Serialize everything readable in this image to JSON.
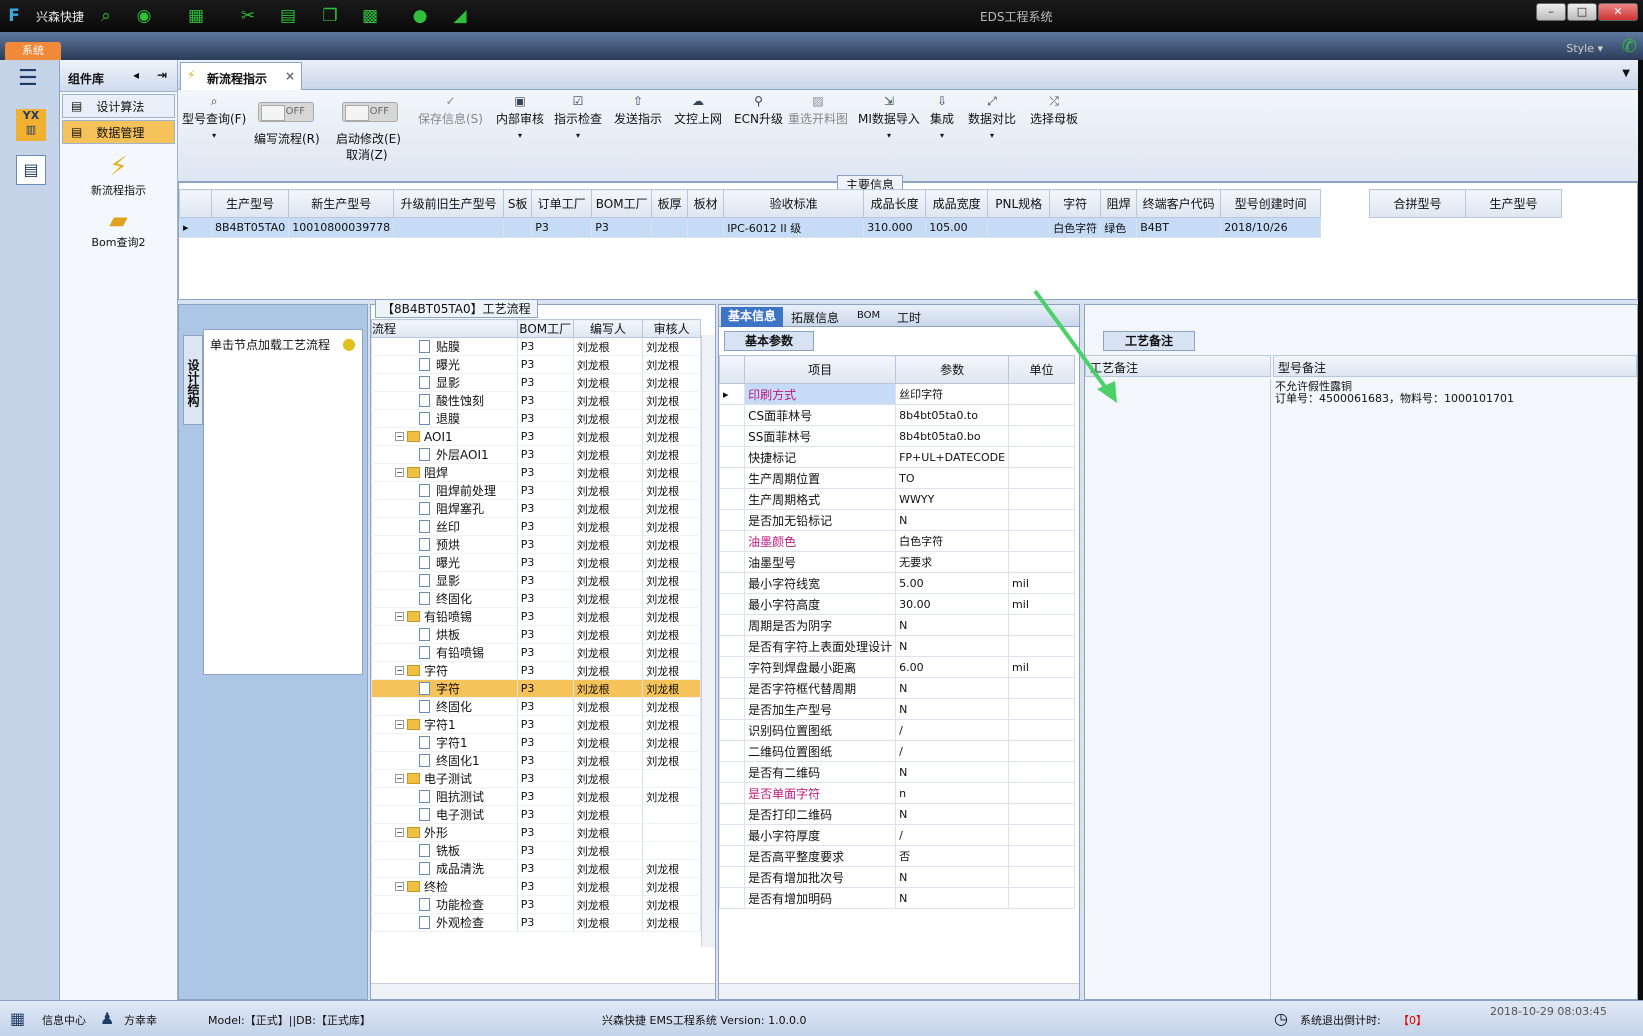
{
  "app": {
    "short_title": "兴森快捷",
    "window_title": "EDS工程系统",
    "system_tab": "系统",
    "style_label": "Style ▾"
  },
  "sidebar": {
    "header": "组件库",
    "items": [
      {
        "label": "设计算法"
      },
      {
        "label": "数据管理"
      }
    ],
    "big_items": [
      {
        "label": "新流程指示"
      },
      {
        "label": "Bom查询2"
      }
    ]
  },
  "tab": {
    "label": "新流程指示",
    "close": "×"
  },
  "toolbar": {
    "model_query": "型号查询(F)",
    "write_flow": "编写流程(R)",
    "start_modify": "启动修改(E)",
    "cancel": "取消(Z)",
    "toggle_off": "OFF",
    "buttons": [
      "保存信息(S)",
      "内部审核",
      "指示检查",
      "发送指示",
      "文控上网",
      "ECN升级",
      "重选开料图",
      "MI数据导入",
      "集成",
      "数据对比",
      "选择母板"
    ]
  },
  "main_info": {
    "title": "主要信息",
    "columns": [
      "生产型号",
      "新生产型号",
      "升级前旧生产型号",
      "S板",
      "订单工厂",
      "BOM工厂",
      "板厚",
      "板材",
      "验收标准",
      "成品长度",
      "成品宽度",
      "PNL规格",
      "字符",
      "阻焊",
      "终端客户代码",
      "型号创建时间"
    ],
    "row": [
      "8B4BT05TA0",
      "10010800039778",
      "",
      "",
      "P3",
      "P3",
      "",
      "",
      "IPC-6012 II 级",
      "310.000",
      "105.00",
      "",
      "白色字符",
      "绿色",
      "B4BT",
      "2018/10/26"
    ],
    "side_columns": [
      "合拼型号",
      "生产型号"
    ]
  },
  "left_panel": {
    "vertical_tab": "设计结构",
    "hint": "单击节点加载工艺流程"
  },
  "process": {
    "title": "【8B4BT05TA0】工艺流程",
    "columns": [
      "流程",
      "BOM工厂",
      "编写人",
      "审核人"
    ],
    "rows": [
      {
        "n": "贴膜",
        "l": 2,
        "b": "P3",
        "w": "刘龙根",
        "r": "刘龙根"
      },
      {
        "n": "曝光",
        "l": 2,
        "b": "P3",
        "w": "刘龙根",
        "r": "刘龙根"
      },
      {
        "n": "显影",
        "l": 2,
        "b": "P3",
        "w": "刘龙根",
        "r": "刘龙根"
      },
      {
        "n": "酸性蚀刻",
        "l": 2,
        "b": "P3",
        "w": "刘龙根",
        "r": "刘龙根"
      },
      {
        "n": "退膜",
        "l": 2,
        "b": "P3",
        "w": "刘龙根",
        "r": "刘龙根"
      },
      {
        "n": "AOI1",
        "l": 1,
        "b": "P3",
        "w": "刘龙根",
        "r": "刘龙根"
      },
      {
        "n": "外层AOI1",
        "l": 2,
        "b": "P3",
        "w": "刘龙根",
        "r": "刘龙根"
      },
      {
        "n": "阻焊",
        "l": 1,
        "b": "P3",
        "w": "刘龙根",
        "r": "刘龙根"
      },
      {
        "n": "阻焊前处理",
        "l": 2,
        "b": "P3",
        "w": "刘龙根",
        "r": "刘龙根"
      },
      {
        "n": "阻焊塞孔",
        "l": 2,
        "b": "P3",
        "w": "刘龙根",
        "r": "刘龙根"
      },
      {
        "n": "丝印",
        "l": 2,
        "b": "P3",
        "w": "刘龙根",
        "r": "刘龙根"
      },
      {
        "n": "预烘",
        "l": 2,
        "b": "P3",
        "w": "刘龙根",
        "r": "刘龙根"
      },
      {
        "n": "曝光",
        "l": 2,
        "b": "P3",
        "w": "刘龙根",
        "r": "刘龙根"
      },
      {
        "n": "显影",
        "l": 2,
        "b": "P3",
        "w": "刘龙根",
        "r": "刘龙根"
      },
      {
        "n": "终固化",
        "l": 2,
        "b": "P3",
        "w": "刘龙根",
        "r": "刘龙根"
      },
      {
        "n": "有铅喷锡",
        "l": 1,
        "b": "P3",
        "w": "刘龙根",
        "r": "刘龙根"
      },
      {
        "n": "烘板",
        "l": 2,
        "b": "P3",
        "w": "刘龙根",
        "r": "刘龙根"
      },
      {
        "n": "有铅喷锡",
        "l": 2,
        "b": "P3",
        "w": "刘龙根",
        "r": "刘龙根"
      },
      {
        "n": "字符",
        "l": 1,
        "b": "P3",
        "w": "刘龙根",
        "r": "刘龙根"
      },
      {
        "n": "字符",
        "l": 2,
        "b": "P3",
        "w": "刘龙根",
        "r": "刘龙根",
        "sel": true
      },
      {
        "n": "终固化",
        "l": 2,
        "b": "P3",
        "w": "刘龙根",
        "r": "刘龙根"
      },
      {
        "n": "字符1",
        "l": 1,
        "b": "P3",
        "w": "刘龙根",
        "r": "刘龙根"
      },
      {
        "n": "字符1",
        "l": 2,
        "b": "P3",
        "w": "刘龙根",
        "r": "刘龙根"
      },
      {
        "n": "终固化1",
        "l": 2,
        "b": "P3",
        "w": "刘龙根",
        "r": "刘龙根"
      },
      {
        "n": "电子测试",
        "l": 1,
        "b": "P3",
        "w": "刘龙根",
        "r": ""
      },
      {
        "n": "阻抗测试",
        "l": 2,
        "b": "P3",
        "w": "刘龙根",
        "r": "刘龙根"
      },
      {
        "n": "电子测试",
        "l": 2,
        "b": "P3",
        "w": "刘龙根",
        "r": ""
      },
      {
        "n": "外形",
        "l": 1,
        "b": "P3",
        "w": "刘龙根",
        "r": ""
      },
      {
        "n": "铣板",
        "l": 2,
        "b": "P3",
        "w": "刘龙根",
        "r": ""
      },
      {
        "n": "成品清洗",
        "l": 2,
        "b": "P3",
        "w": "刘龙根",
        "r": "刘龙根"
      },
      {
        "n": "终检",
        "l": 1,
        "b": "P3",
        "w": "刘龙根",
        "r": "刘龙根"
      },
      {
        "n": "功能检查",
        "l": 2,
        "b": "P3",
        "w": "刘龙根",
        "r": "刘龙根"
      },
      {
        "n": "外观检查",
        "l": 2,
        "b": "P3",
        "w": "刘龙根",
        "r": "刘龙根"
      }
    ]
  },
  "info": {
    "tabs": [
      "基本信息",
      "拓展信息",
      "BOM",
      "工时"
    ],
    "sub_tab": "基本参数",
    "columns": [
      "项目",
      "参数",
      "单位"
    ],
    "rows": [
      {
        "item": "印刷方式",
        "value": "丝印字符",
        "unit": "",
        "hl": true
      },
      {
        "item": "CS面菲林号",
        "value": "8b4bt05ta0.to",
        "unit": ""
      },
      {
        "item": "SS面菲林号",
        "value": "8b4bt05ta0.bo",
        "unit": ""
      },
      {
        "item": "快捷标记",
        "value": "FP+UL+DATECODE",
        "unit": ""
      },
      {
        "item": "生产周期位置",
        "value": "TO",
        "unit": ""
      },
      {
        "item": "生产周期格式",
        "value": "WWYY",
        "unit": ""
      },
      {
        "item": "是否加无铅标记",
        "value": "N",
        "unit": ""
      },
      {
        "item": "油墨颜色",
        "value": "白色字符",
        "unit": "",
        "hl": true
      },
      {
        "item": "油墨型号",
        "value": "无要求",
        "unit": ""
      },
      {
        "item": "最小字符线宽",
        "value": "5.00",
        "unit": "mil"
      },
      {
        "item": "最小字符高度",
        "value": "30.00",
        "unit": "mil"
      },
      {
        "item": "周期是否为阴字",
        "value": "N",
        "unit": ""
      },
      {
        "item": "是否有字符上表面处理设计",
        "value": "N",
        "unit": ""
      },
      {
        "item": "字符到焊盘最小距离",
        "value": "6.00",
        "unit": "mil"
      },
      {
        "item": "是否字符框代替周期",
        "value": "N",
        "unit": ""
      },
      {
        "item": "是否加生产型号",
        "value": "N",
        "unit": ""
      },
      {
        "item": "识别码位置图纸",
        "value": "/",
        "unit": ""
      },
      {
        "item": "二维码位置图纸",
        "value": "/",
        "unit": ""
      },
      {
        "item": "是否有二维码",
        "value": "N",
        "unit": ""
      },
      {
        "item": "是否单面字符",
        "value": "n",
        "unit": "",
        "hl": true
      },
      {
        "item": "是否打印二维码",
        "value": "N",
        "unit": ""
      },
      {
        "item": "最小字符厚度",
        "value": "/",
        "unit": ""
      },
      {
        "item": "是否高平整度要求",
        "value": "否",
        "unit": ""
      },
      {
        "item": "是否有增加批次号",
        "value": "N",
        "unit": ""
      },
      {
        "item": "是否有增加明码",
        "value": "N",
        "unit": ""
      }
    ]
  },
  "notes": {
    "tab": "工艺备注",
    "col1": "工艺备注",
    "col2": "型号备注",
    "model_note_1": "不允许假性露铜",
    "model_note_2": "订单号：4500061683，物料号：1000101701"
  },
  "status": {
    "info_center": "信息中心",
    "user": "方幸幸",
    "model": "Model:【正式】||DB:【正式库】",
    "version": "兴森快捷  EMS工程系统  Version: 1.0.0.0",
    "countdown_label": "系统退出倒计时:",
    "countdown_value": "【0】",
    "datetime": "2018-10-29 08:03:45"
  },
  "colors": {
    "accent": "#f6c25a",
    "highlight_text": "#c0197d",
    "arrow": "#4cd06a",
    "selection": "#c6dcf6"
  }
}
